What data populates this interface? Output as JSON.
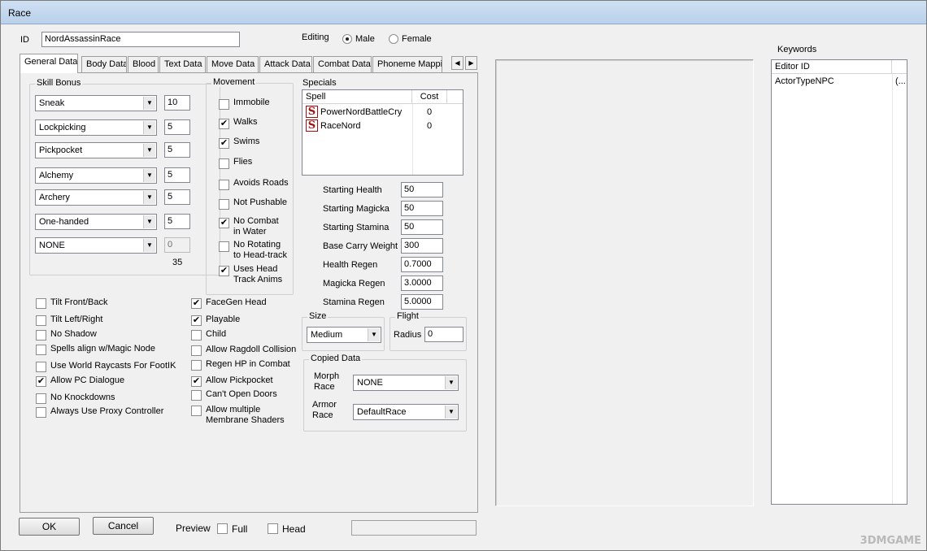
{
  "window": {
    "title": "Race"
  },
  "header": {
    "id_label": "ID",
    "id_value": "NordAssassinRace",
    "editing_label": "Editing",
    "male_label": "Male",
    "female_label": "Female"
  },
  "tabs": [
    "General Data",
    "Body Data",
    "Blood",
    "Text Data",
    "Move Data",
    "Attack Data",
    "Combat Data",
    "Phoneme Mappi"
  ],
  "skill_bonus": {
    "title": "Skill Bonus",
    "rows": [
      {
        "skill": "Sneak",
        "value": "10"
      },
      {
        "skill": "Lockpicking",
        "value": "5"
      },
      {
        "skill": "Pickpocket",
        "value": "5"
      },
      {
        "skill": "Alchemy",
        "value": "5"
      },
      {
        "skill": "Archery",
        "value": "5"
      },
      {
        "skill": "One-handed",
        "value": "5"
      },
      {
        "skill": "NONE",
        "value": "0"
      }
    ],
    "total": "35"
  },
  "movement": {
    "title": "Movement",
    "items": [
      {
        "label": "Immobile",
        "checked": false
      },
      {
        "label": "Walks",
        "checked": true
      },
      {
        "label": "Swims",
        "checked": true
      },
      {
        "label": "Flies",
        "checked": false
      },
      {
        "label": "Avoids Roads",
        "checked": false
      },
      {
        "label": "Not Pushable",
        "checked": false
      },
      {
        "label": "No Combat\nin Water",
        "checked": true
      },
      {
        "label": "No Rotating\nto Head-track",
        "checked": false
      },
      {
        "label": "Uses Head\nTrack Anims",
        "checked": true
      }
    ]
  },
  "specials": {
    "title": "Specials",
    "col_spell": "Spell",
    "col_cost": "Cost",
    "rows": [
      {
        "spell": "PowerNordBattleCry",
        "cost": "0"
      },
      {
        "spell": "RaceNord",
        "cost": "0"
      }
    ],
    "icon_glyph": "S"
  },
  "stats": [
    {
      "label": "Starting Health",
      "value": "50"
    },
    {
      "label": "Starting Magicka",
      "value": "50"
    },
    {
      "label": "Starting Stamina",
      "value": "50"
    },
    {
      "label": "Base Carry Weight",
      "value": "300"
    },
    {
      "label": "Health Regen",
      "value": "0.7000"
    },
    {
      "label": "Magicka Regen",
      "value": "3.0000"
    },
    {
      "label": "Stamina Regen",
      "value": "5.0000"
    }
  ],
  "size": {
    "title": "Size",
    "value": "Medium"
  },
  "flight": {
    "title": "Flight",
    "radius_label": "Radius",
    "radius_value": "0"
  },
  "copied_data": {
    "title": "Copied Data",
    "morph_label": "Morph\nRace",
    "morph_value": "NONE",
    "armor_label": "Armor\nRace",
    "armor_value": "DefaultRace"
  },
  "flags_left": [
    {
      "label": "Tilt Front/Back",
      "checked": false
    },
    {
      "label": "Tilt Left/Right",
      "checked": false
    },
    {
      "label": "No Shadow",
      "checked": false
    },
    {
      "label": "Spells align w/Magic Node",
      "checked": false
    },
    {
      "label": "Use World Raycasts For FootIK",
      "checked": false
    },
    {
      "label": "Allow PC Dialogue",
      "checked": true
    },
    {
      "label": "No Knockdowns",
      "checked": false
    },
    {
      "label": "Always Use Proxy Controller",
      "checked": false
    }
  ],
  "flags_right": [
    {
      "label": "FaceGen Head",
      "checked": true
    },
    {
      "label": "Playable",
      "checked": true
    },
    {
      "label": "Child",
      "checked": false
    },
    {
      "label": "Allow Ragdoll Collision",
      "checked": false
    },
    {
      "label": "Regen HP in Combat",
      "checked": false
    },
    {
      "label": "Allow Pickpocket",
      "checked": true
    },
    {
      "label": "Can't Open Doors",
      "checked": false
    },
    {
      "label": "Allow multiple\nMembrane Shaders",
      "checked": false
    }
  ],
  "keywords": {
    "title": "Keywords",
    "col_editor_id": "Editor ID",
    "rows": [
      {
        "editor_id": "ActorTypeNPC",
        "extra": "(..."
      }
    ]
  },
  "footer": {
    "ok_label": "OK",
    "cancel_label": "Cancel",
    "preview_label": "Preview",
    "full_label": "Full",
    "head_label": "Head"
  },
  "watermark": "3DMGAME"
}
